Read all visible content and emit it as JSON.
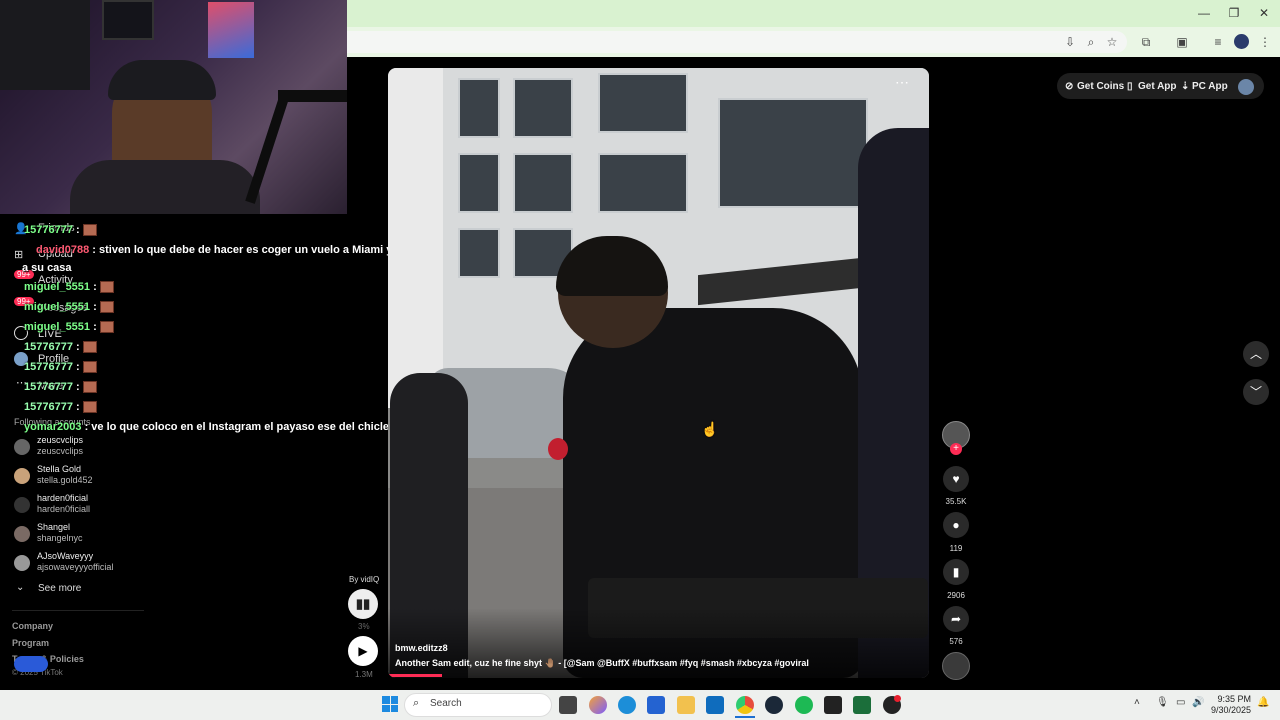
{
  "window": {
    "minimize_icon": "—",
    "maximize_icon": "❐",
    "close_icon": "✕"
  },
  "top_right": {
    "get_coins": "Get Coins",
    "get_app": "Get App",
    "pc_app": "PC App"
  },
  "sidebar": {
    "items": [
      {
        "label": "Friends",
        "badge": ""
      },
      {
        "label": "Upload",
        "badge": ""
      },
      {
        "label": "Activity",
        "badge": "99+"
      },
      {
        "label": "Messages",
        "badge": "99+"
      },
      {
        "label": "LIVE",
        "badge": ""
      },
      {
        "label": "Profile",
        "badge": ""
      },
      {
        "label": "More",
        "badge": ""
      }
    ],
    "following_header": "Following accounts",
    "accounts": [
      {
        "name": "zeuscvclips",
        "handle": "zeuscvclips"
      },
      {
        "name": "Stella Gold",
        "handle": "stella.gold452"
      },
      {
        "name": "harden0ficial",
        "handle": "harden0ficiall"
      },
      {
        "name": "Shangel",
        "handle": "shangelnyc"
      },
      {
        "name": "AJsoWaveyyy",
        "handle": "ajsowaveyyyofficial"
      }
    ],
    "see_more": "See more",
    "footer": [
      "Company",
      "Program",
      "Terms & Policies",
      "© 2025 TikTok"
    ]
  },
  "chat": [
    {
      "user": "15776777",
      "msg": ":",
      "emote": true
    },
    {
      "user": "david0788",
      "msg": ": stiven lo que debe de hacer es coger un vuelo a Miami y llegarle",
      "emote": false
    },
    {
      "user": "",
      "msg": "a su casa",
      "emote": false
    },
    {
      "user": "miguel_5551",
      "msg": ":",
      "emote": true
    },
    {
      "user": "miguel_5551",
      "msg": ":",
      "emote": true
    },
    {
      "user": "miguel_5551",
      "msg": ":",
      "emote": true
    },
    {
      "user": "15776777",
      "msg": ":",
      "emote": true
    },
    {
      "user": "15776777",
      "msg": ":",
      "emote": true
    },
    {
      "user": "15776777",
      "msg": ":",
      "emote": true
    },
    {
      "user": "15776777",
      "msg": ":",
      "emote": true
    },
    {
      "user": "yomar2003",
      "msg": ": ve lo que coloco en el Instagram el payaso ese del chicle",
      "emote": false
    }
  ],
  "vidiq": {
    "by_label": "By vidIQ",
    "percent": "3%",
    "views": "1.3M"
  },
  "video": {
    "author": "bmw.editzz8",
    "caption": "Another Sam edit, cuz he fine shyt 🤚🏽 - [@Sam @BuffX #buffxsam #fyq #smash #xbcyza #goviral",
    "more_icon": "⋯"
  },
  "rail": {
    "likes": "35.5K",
    "comments": "119",
    "saves": "2906",
    "shares": "576"
  },
  "taskbar": {
    "search_placeholder": "Search",
    "time": "9:35 PM",
    "date": "9/30/2025"
  },
  "colors": {
    "accent": "#fe2c55",
    "chrome_bg": "#d9f2d0",
    "chat_user": "#7dff8a"
  }
}
